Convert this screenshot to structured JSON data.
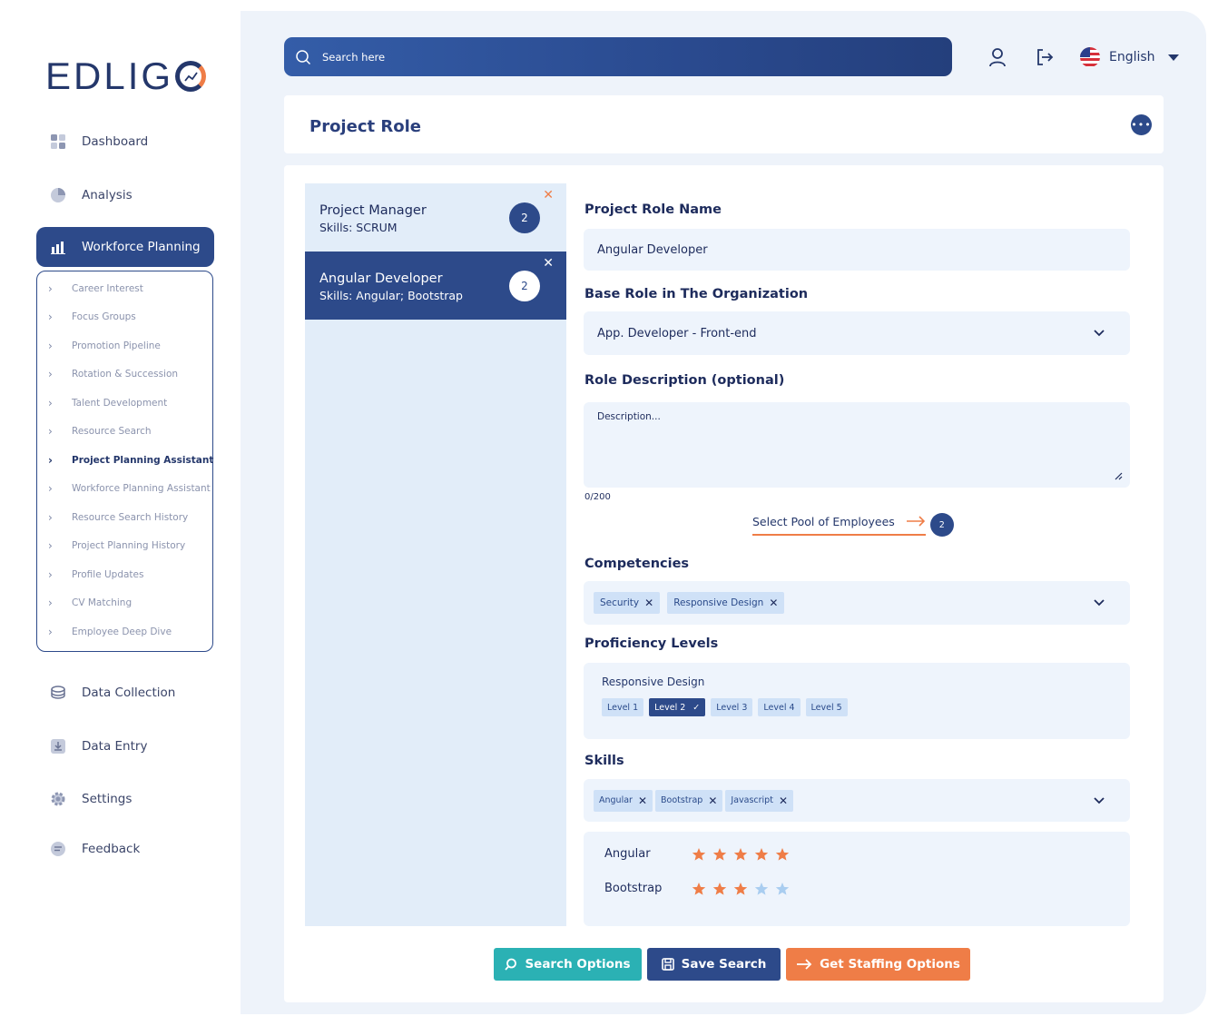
{
  "brand": {
    "logo_text": "EDLIG"
  },
  "sidebar": {
    "items": [
      {
        "label": "Dashboard",
        "icon": "dashboard-icon"
      },
      {
        "label": "Analysis",
        "icon": "pie-chart-icon"
      },
      {
        "label": "Workforce Planning",
        "icon": "chart-bar-icon"
      },
      {
        "label": "Data Collection",
        "icon": "database-icon"
      },
      {
        "label": "Data Entry",
        "icon": "download-icon"
      },
      {
        "label": "Settings",
        "icon": "gear-icon"
      },
      {
        "label": "Feedback",
        "icon": "chat-icon"
      }
    ],
    "submenu": [
      "Career Interest",
      "Focus Groups",
      "Promotion Pipeline",
      "Rotation & Succession",
      "Talent Development",
      "Resource Search",
      "Project Planning Assistant",
      "Workforce Planning Assistant",
      "Resource Search History",
      "Project Planning History",
      "Profile Updates",
      "CV Matching",
      "Employee Deep Dive"
    ],
    "active_submenu": "Project Planning Assistant"
  },
  "topbar": {
    "search_placeholder": "Search here",
    "language": "English"
  },
  "page": {
    "title": "Project Role"
  },
  "roles": [
    {
      "title": "Project Manager",
      "skills": "Skills: SCRUM",
      "count": "2"
    },
    {
      "title": "Angular Developer",
      "skills": "Skills: Angular; Bootstrap",
      "count": "2"
    }
  ],
  "form": {
    "role_name_label": "Project Role Name",
    "role_name_value": "Angular Developer",
    "base_role_label": "Base Role in The Organization",
    "base_role_value": "App. Developer - Front-end",
    "description_label": "Role Description (optional)",
    "description_placeholder": "Description...",
    "char_count": "0/200",
    "pool_link": "Select Pool of Employees",
    "pool_count": "2",
    "competencies_label": "Competencies",
    "competencies": [
      "Security",
      "Responsive Design"
    ],
    "proficiency_label": "Proficiency Levels",
    "proficiency_skill": "Responsive Design",
    "levels": [
      "Level 1",
      "Level 2",
      "Level 3",
      "Level 4",
      "Level 5"
    ],
    "selected_level": "Level 2",
    "skills_label": "Skills",
    "skills": [
      "Angular",
      "Bootstrap",
      "Javascript"
    ],
    "ratings": [
      {
        "skill": "Angular",
        "stars": 5,
        "max": 5
      },
      {
        "skill": "Bootstrap",
        "stars": 3,
        "max": 5
      }
    ]
  },
  "actions": {
    "search_options": "Search Options",
    "save_search": "Save Search",
    "get_staffing": "Get Staffing Options"
  },
  "colors": {
    "primary": "#2d4a8a",
    "accent": "#ef7d47",
    "teal": "#2bb1b4",
    "star_on": "#ef7d47",
    "star_off": "#a9cdf0"
  }
}
